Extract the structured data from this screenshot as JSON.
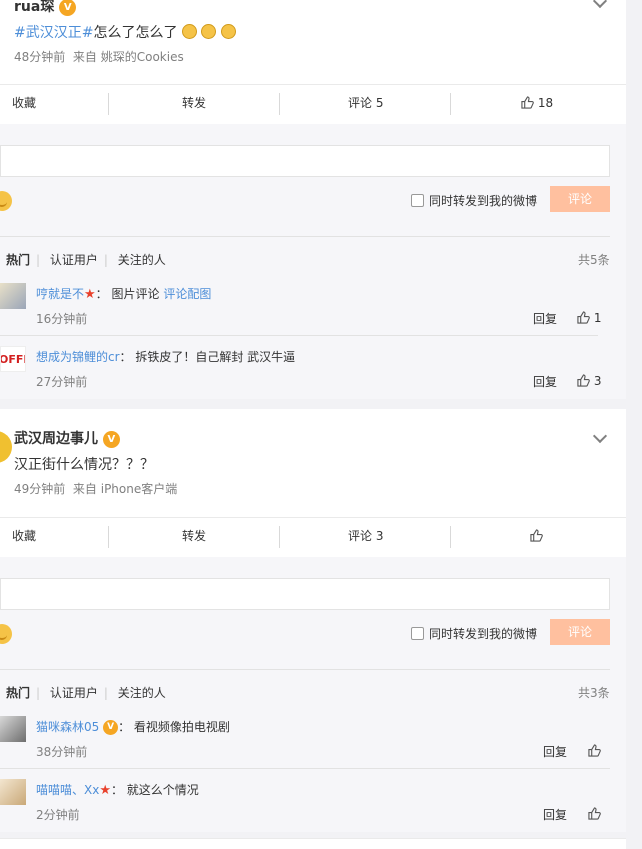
{
  "post1": {
    "username": "rua琛",
    "topic": "#武汉汉正#",
    "text": "怎么了怎么了",
    "time": "48分钟前",
    "source": "来自 姚琛的Cookies",
    "actions": {
      "favorite": "收藏",
      "repost": "转发",
      "comment": "评论 5",
      "likes": "18"
    }
  },
  "composer1": {
    "checkbox_label": "同时转发到我的微博",
    "button": "评论"
  },
  "comments1": {
    "tabs": [
      "热门",
      "认证用户",
      "关注的人"
    ],
    "count": "共5条",
    "items": [
      {
        "user": "哼就是不",
        "text_prefix": "：  图片评论 ",
        "link": "评论配图",
        "time": "16分钟前",
        "reply": "回复",
        "likes": "1"
      },
      {
        "user": "想成为锦鲤的cr",
        "text_prefix": "：  拆铁皮了！自己解封 武汉牛逼",
        "link": "",
        "time": "27分钟前",
        "reply": "回复",
        "likes": "3"
      }
    ]
  },
  "post2": {
    "username": "武汉周边事儿",
    "text": "汉正街什么情况？？？",
    "time": "49分钟前",
    "source": "来自 iPhone客户端",
    "actions": {
      "favorite": "收藏",
      "repost": "转发",
      "comment": "评论 3",
      "likes": ""
    }
  },
  "composer2": {
    "checkbox_label": "同时转发到我的微博",
    "button": "评论"
  },
  "comments2": {
    "tabs": [
      "热门",
      "认证用户",
      "关注的人"
    ],
    "count": "共3条",
    "items": [
      {
        "user": "猫咪森林05",
        "text_prefix": "：  看视频像拍电视剧",
        "time": "38分钟前",
        "reply": "回复"
      },
      {
        "user": "喵喵喵、Xx",
        "text_prefix": "：  就这么个情况",
        "time": "2分钟前",
        "reply": "回复"
      }
    ]
  },
  "colors": {
    "accent": "#4d8ed8",
    "button": "#ffc09f",
    "gold_v": "#f5a623",
    "red_star": "#e8412c"
  }
}
